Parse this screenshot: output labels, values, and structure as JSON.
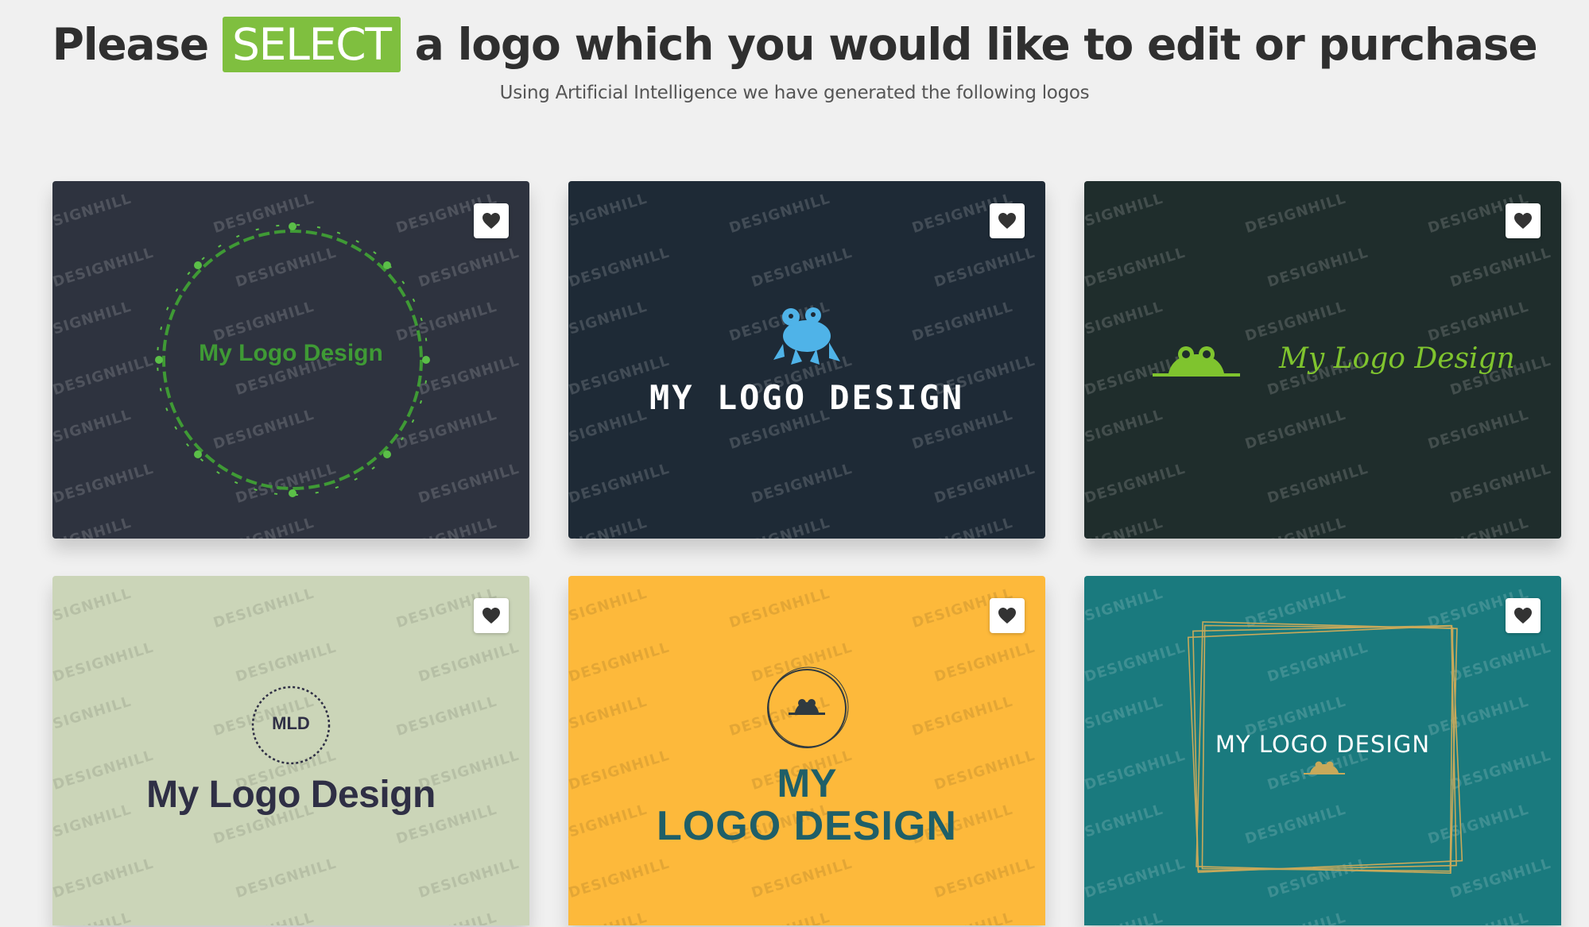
{
  "header": {
    "headline_before": "Please",
    "headline_highlight": "SELECT",
    "headline_after": "a logo which you would like to edit or purchase",
    "subtitle": "Using Artificial Intelligence we have generated the following logos",
    "highlight_color": "#7fbf3f"
  },
  "watermark_text": "DESIGNHILL",
  "favorite_icon": "heart-icon",
  "logos": [
    {
      "background": "#2e333f",
      "text": "My Logo Design",
      "text_color": "#3f9a35",
      "icon": "vine-wreath-icon"
    },
    {
      "background": "#1e2a36",
      "text": "MY LOGO DESIGN",
      "text_color": "#ffffff",
      "icon": "frog-icon",
      "icon_color": "#4fb3e8"
    },
    {
      "background": "#1f2d2c",
      "text": "My Logo Design",
      "text_color": "#7fc42e",
      "icon": "frog-eyes-icon"
    },
    {
      "background": "#cbd5b8",
      "text": "My Logo Design",
      "monogram": "MLD",
      "text_color": "#2f2f45",
      "icon": "dotted-circle-icon"
    },
    {
      "background": "#fdb93b",
      "text_line1": "MY",
      "text_line2": "LOGO DESIGN",
      "text_color": "#1f5f68",
      "icon": "circle-frog-icon"
    },
    {
      "background": "#1a7a7e",
      "text": "MY LOGO DESIGN",
      "text_color": "#ffffff",
      "icon": "gold-frame-icon",
      "icon_color": "#c8a95a"
    }
  ]
}
